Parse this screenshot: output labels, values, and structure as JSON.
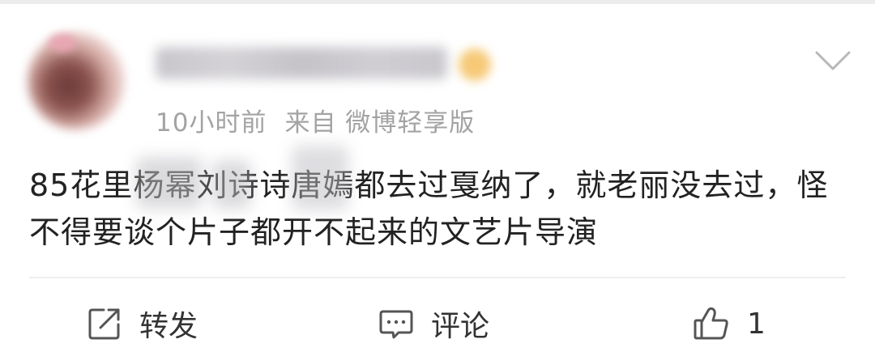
{
  "post": {
    "time": "10小时前",
    "source": "来自 微博轻享版",
    "content": "85花里杨幂刘诗诗唐嫣都去过戛纳了，就老丽没去过，怪不得要谈个片子都开不起来的文艺片导演"
  },
  "actions": {
    "repost": "转发",
    "comment": "评论",
    "like_count": "1"
  },
  "icons": {
    "more": "chevron-down-icon",
    "repost": "repost-icon",
    "comment": "comment-icon",
    "like": "thumbs-up-icon"
  },
  "colors": {
    "text": "#222222",
    "meta": "#a3a3a3",
    "icon": "#555555",
    "divider": "#eeeeee"
  }
}
